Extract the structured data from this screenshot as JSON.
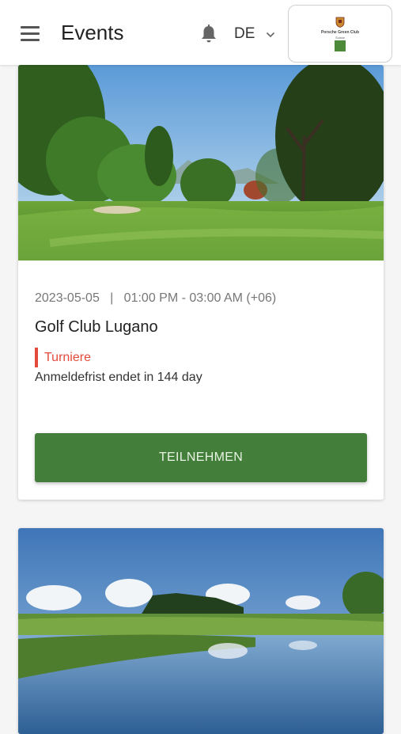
{
  "header": {
    "title": "Events",
    "language": "DE",
    "logo_text": "Porsche Green Club",
    "logo_sub": "Suisse"
  },
  "events": [
    {
      "date": "2023-05-05",
      "time": "01:00 PM - 03:00 AM (+06)",
      "club": "Golf Club Lugano",
      "category": "Turniere",
      "deadline": "Anmeldefrist endet in 144 day",
      "button_label": "TEILNEHMEN"
    }
  ],
  "colors": {
    "accent_green": "#437f3a",
    "tag_red": "#e34a3a"
  }
}
